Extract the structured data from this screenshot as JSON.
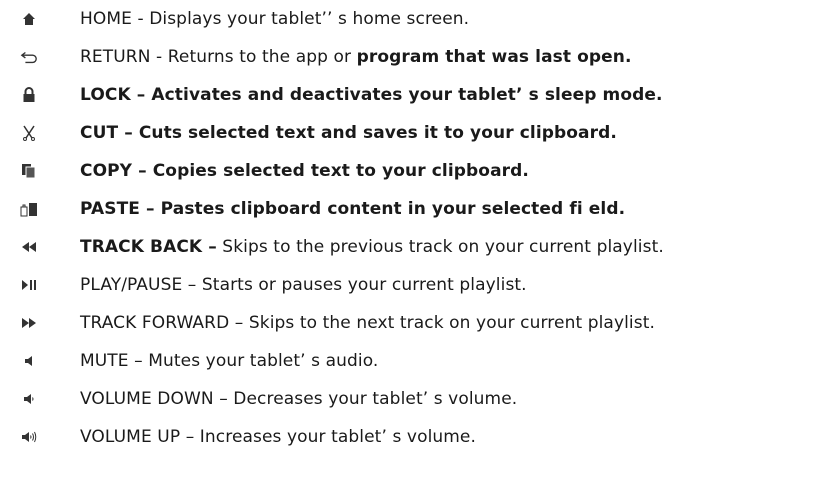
{
  "items": [
    {
      "icon": "home-icon",
      "parts": [
        {
          "t": "HOME - Displays your tablet’’ s home screen.",
          "b": false
        }
      ]
    },
    {
      "icon": "return-arrow-icon",
      "parts": [
        {
          "t": "RETURN - Returns to the app or ",
          "b": false
        },
        {
          "t": "program that was last open.",
          "b": true
        }
      ]
    },
    {
      "icon": "lock-icon",
      "parts": [
        {
          "t": "LOCK – Activates and deactivates your tablet’ s sleep mode.",
          "b": true
        }
      ]
    },
    {
      "icon": "scissors-icon",
      "parts": [
        {
          "t": "CUT – Cuts selected text and saves it to your clipboard.",
          "b": true
        }
      ]
    },
    {
      "icon": "copy-icon",
      "parts": [
        {
          "t": "COPY – Copies selected text to your clipboard.",
          "b": true
        }
      ]
    },
    {
      "icon": "paste-icon",
      "parts": [
        {
          "t": "PASTE – Pastes clipboard content in your selected fi eld.",
          "b": true
        }
      ]
    },
    {
      "icon": "track-back-icon",
      "parts": [
        {
          "t": "TRACK BACK –",
          "b": true
        },
        {
          "t": " Skips to the previous track on your current playlist.",
          "b": false
        }
      ]
    },
    {
      "icon": "play-pause-icon",
      "parts": [
        {
          "t": "PLAY/PAUSE – Starts or pauses your current playlist.",
          "b": false
        }
      ]
    },
    {
      "icon": "track-forward-icon",
      "parts": [
        {
          "t": "TRACK FORWARD – Skips to the next track on your current playlist.",
          "b": false
        }
      ]
    },
    {
      "icon": "mute-icon",
      "parts": [
        {
          "t": "MUTE – Mutes your tablet’ s audio.",
          "b": false
        }
      ]
    },
    {
      "icon": "volume-down-icon",
      "parts": [
        {
          "t": "VOLUME DOWN – Decreases your tablet’ s volume.",
          "b": false
        }
      ]
    },
    {
      "icon": "volume-up-icon",
      "parts": [
        {
          "t": "VOLUME UP – Increases your tablet’ s volume.",
          "b": false
        }
      ]
    }
  ]
}
